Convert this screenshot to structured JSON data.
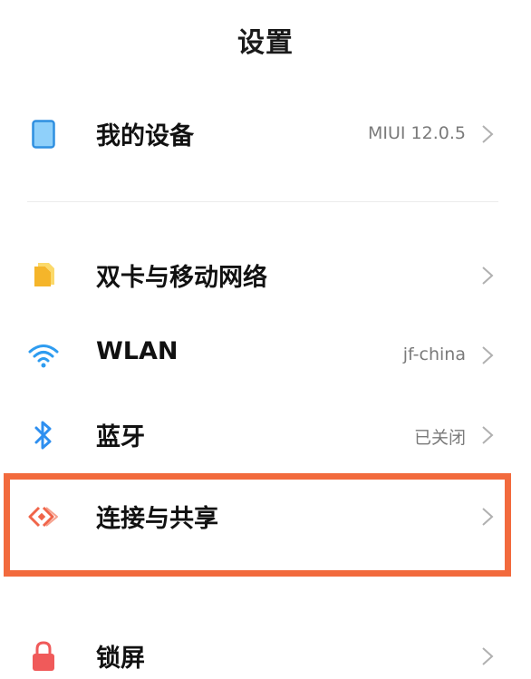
{
  "header": {
    "title": "设置"
  },
  "items": [
    {
      "label": "我的设备",
      "value": "MIUI 12.0.5",
      "icon": "tablet-icon",
      "color": "#4ab0f0"
    },
    {
      "label": "双卡与移动网络",
      "value": "",
      "icon": "sim-card-icon",
      "color": "#f7c53b"
    },
    {
      "label": "WLAN",
      "value": "jf-china",
      "icon": "wifi-icon",
      "color": "#2e9cf0"
    },
    {
      "label": "蓝牙",
      "value": "已关闭",
      "icon": "bluetooth-icon",
      "color": "#2e8ff0"
    },
    {
      "label": "连接与共享",
      "value": "",
      "icon": "connection-share-icon",
      "color": "#f0654a"
    },
    {
      "label": "锁屏",
      "value": "",
      "icon": "lock-icon",
      "color": "#f05a5a"
    }
  ],
  "highlight_color": "#f26a3d"
}
